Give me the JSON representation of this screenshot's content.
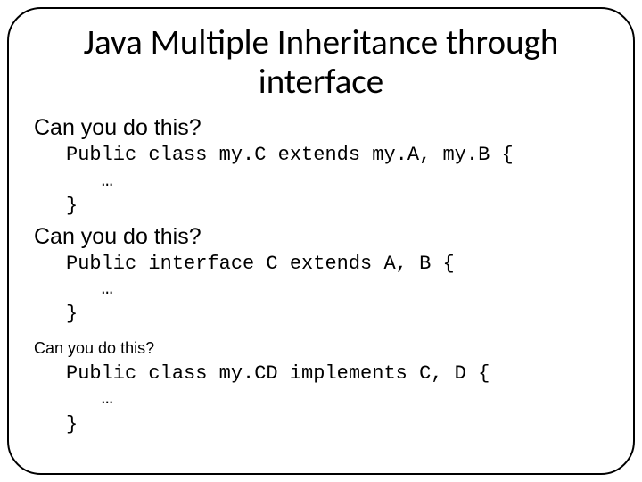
{
  "title": "Java Multiple Inheritance through interface",
  "sections": [
    {
      "question": "Can you do this?",
      "code": "Public class my.C extends my.A, my.B {\n   …\n}"
    },
    {
      "question": "Can you do this?",
      "code": "Public interface C extends A, B {\n   …\n}"
    },
    {
      "question": "Can you do this?",
      "code": "Public class my.CD implements C, D {\n   …\n}"
    }
  ]
}
